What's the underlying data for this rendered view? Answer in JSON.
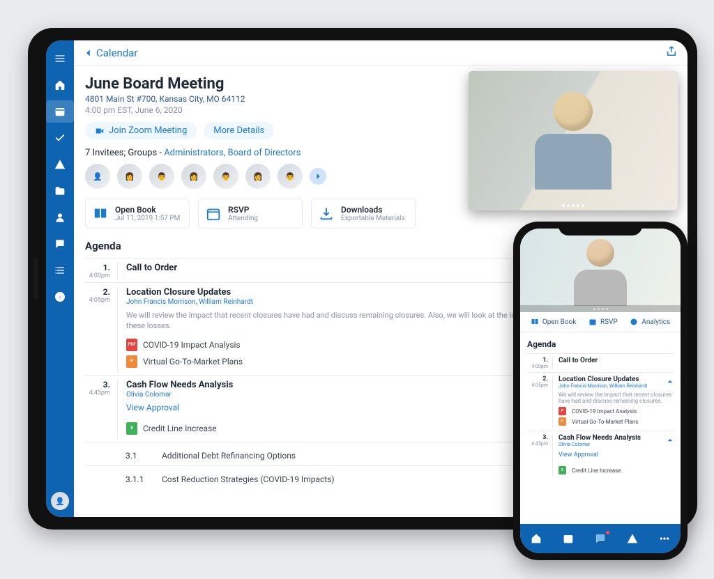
{
  "breadcrumb": {
    "back_label": "Calendar"
  },
  "meeting": {
    "title": "June Board Meeting",
    "address": "4801 Main St #700, Kansas City, MO 64112",
    "time": "4:00 pm EST,  June 6, 2020"
  },
  "actions": {
    "join_label": "Join Zoom Meeting",
    "details_label": "More Details"
  },
  "invitees": {
    "prefix": "7 Invitees; Groups - ",
    "groups": "Administrators, Board of Directors"
  },
  "cards": {
    "openbook": {
      "label": "Open Book",
      "sublabel": "Jul 11, 2019 1:57 PM"
    },
    "rsvp": {
      "label": "RSVP",
      "sublabel": "Attending"
    },
    "downloads": {
      "label": "Downloads",
      "sublabel": "Exportable Materials"
    }
  },
  "agenda": {
    "heading": "Agenda",
    "items": [
      {
        "num": "1.",
        "time": "4:00pm",
        "title": "Call to Order"
      },
      {
        "num": "2.",
        "time": "4:05pm",
        "title": "Location Closure Updates",
        "subtitle": "John Francis Morrison, William Reinhardt",
        "description": "We will review the impact that recent closures have had and discuss remaining closures. Also, we will look at the impact to the P&L and strategies to address these losses.",
        "files": [
          {
            "type": "pdf",
            "label": "COVID-19 Impact Analysis"
          },
          {
            "type": "ppt",
            "label": "Virtual Go-To-Market Plans"
          }
        ]
      },
      {
        "num": "3.",
        "time": "4:45pm",
        "title": "Cash Flow Needs Analysis",
        "subtitle": "Olivia Colomar",
        "link": "View Approval",
        "files": [
          {
            "type": "xls",
            "label": "Credit Line Increase"
          }
        ],
        "children": [
          {
            "num": "3.1",
            "label": "Additional Debt Refinancing Options"
          },
          {
            "num": "3.1.1",
            "label": "Cost Reduction Strategies (COVID-19 Impacts)"
          }
        ]
      }
    ]
  },
  "phone": {
    "tabs": {
      "openbook": "Open Book",
      "rsvp": "RSVP",
      "analytics": "Analytics"
    },
    "agenda_heading": "Agenda",
    "items": [
      {
        "num": "1.",
        "time": "4:00pm",
        "title": "Call to Order"
      },
      {
        "num": "2.",
        "time": "4:05pm",
        "title": "Location Closure Updates",
        "subtitle": "John Francis Morrison, William Reinhardt",
        "description": "We will review the impact that recent closures have had and discuss remaining closures.",
        "files": [
          {
            "type": "pdf",
            "label": "COVID-19 Impact Analysis"
          },
          {
            "type": "ppt",
            "label": "Virtual Go-To-Market Plans"
          }
        ]
      },
      {
        "num": "3.",
        "time": "4:45pm",
        "title": "Cash Flow Needs Analysis",
        "subtitle": "Olivia Colomar",
        "link": "View Approval",
        "files": [
          {
            "type": "xls",
            "label": "Credit Line Increase"
          }
        ]
      }
    ]
  }
}
